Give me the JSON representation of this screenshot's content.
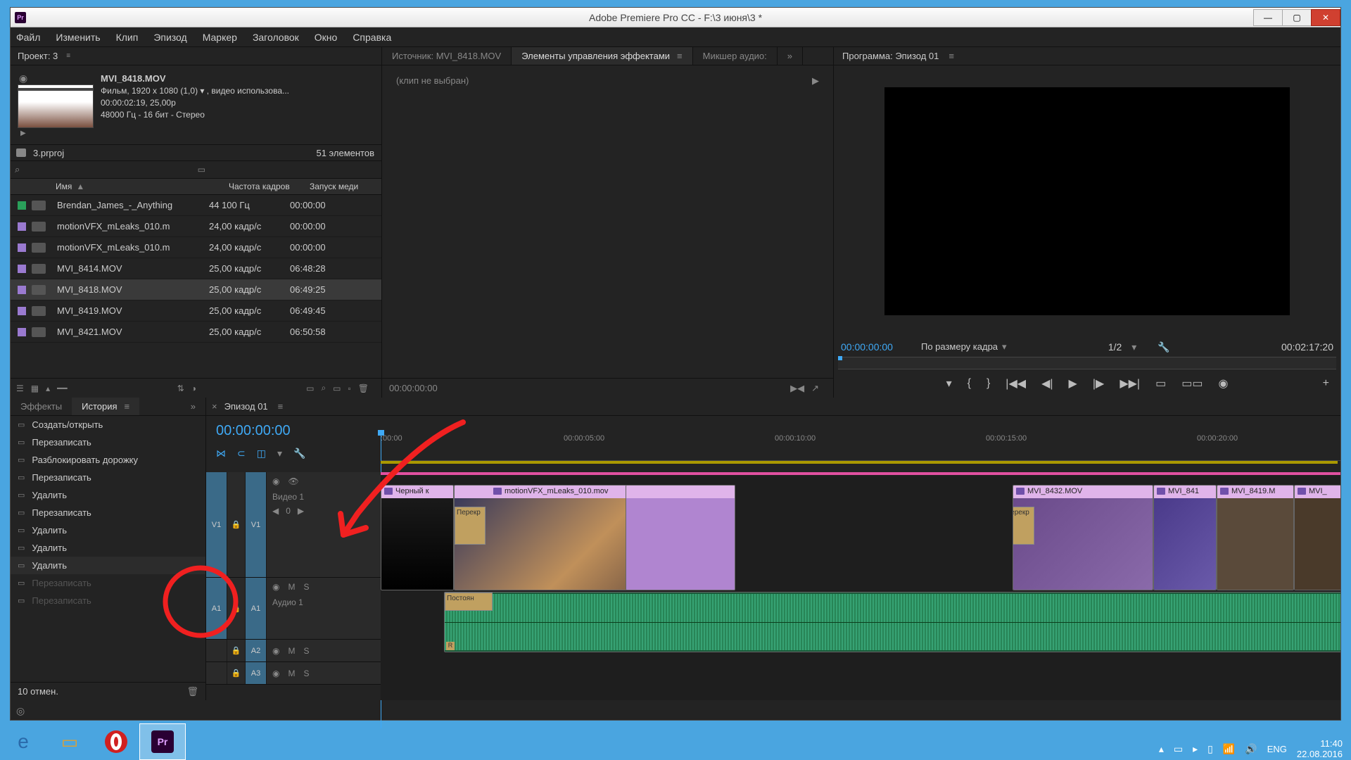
{
  "titlebar": {
    "title": "Adobe Premiere Pro CC - F:\\3 июня\\3 *"
  },
  "menubar": [
    "Файл",
    "Изменить",
    "Клип",
    "Эпизод",
    "Маркер",
    "Заголовок",
    "Окно",
    "Справка"
  ],
  "project": {
    "title": "Проект: 3",
    "clip": {
      "name": "MVI_8418.MOV",
      "line1": "Фильм, 1920 x 1080 (1,0) ▾ , видео использова...",
      "line2": "00:00:02:19, 25,00p",
      "line3": "48000 Гц - 16 бит - Стерео"
    },
    "bin": {
      "name": "3.prproj",
      "count": "51 элементов"
    },
    "cols": {
      "name": "Имя",
      "fps": "Частота кадров",
      "start": "Запуск меди"
    },
    "assets": [
      {
        "color": "#2aa05a",
        "name": "Brendan_James_-_Anything",
        "fps": "44 100 Гц",
        "start": "00:00:00"
      },
      {
        "color": "#9a7ad0",
        "name": "motionVFX_mLeaks_010.m",
        "fps": "24,00 кадр/с",
        "start": "00:00:00"
      },
      {
        "color": "#9a7ad0",
        "name": "motionVFX_mLeaks_010.m",
        "fps": "24,00 кадр/с",
        "start": "00:00:00"
      },
      {
        "color": "#9a7ad0",
        "name": "MVI_8414.MOV",
        "fps": "25,00 кадр/с",
        "start": "06:48:28"
      },
      {
        "color": "#9a7ad0",
        "name": "MVI_8418.MOV",
        "fps": "25,00 кадр/с",
        "start": "06:49:25",
        "sel": true
      },
      {
        "color": "#9a7ad0",
        "name": "MVI_8419.MOV",
        "fps": "25,00 кадр/с",
        "start": "06:49:45"
      },
      {
        "color": "#9a7ad0",
        "name": "MVI_8421.MOV",
        "fps": "25,00 кадр/с",
        "start": "06:50:58"
      }
    ]
  },
  "source": {
    "tabs": [
      "Источник: MVI_8418.MOV",
      "Элементы управления эффектами",
      "Микшер аудио:"
    ],
    "active_tab": 1,
    "empty": "(клип не выбран)",
    "footer_tc": "00:00:00:00"
  },
  "program": {
    "title": "Программа: Эпизод 01",
    "timecode": "00:00:00:00",
    "zoom": "По размеру кадра",
    "page": "1/2",
    "duration": "00:02:17:20"
  },
  "effects": {
    "tab1": "Эффекты",
    "tab2": "История",
    "items": [
      {
        "label": "Создать/открыть",
        "state": ""
      },
      {
        "label": "Перезаписать",
        "state": ""
      },
      {
        "label": "Разблокировать дорожку",
        "state": ""
      },
      {
        "label": "Перезаписать",
        "state": ""
      },
      {
        "label": "Удалить",
        "state": ""
      },
      {
        "label": "Перезаписать",
        "state": ""
      },
      {
        "label": "Удалить",
        "state": ""
      },
      {
        "label": "Удалить",
        "state": ""
      },
      {
        "label": "Удалить",
        "state": "current"
      },
      {
        "label": "Перезаписать",
        "state": "dim"
      },
      {
        "label": "Перезаписать",
        "state": "dim"
      }
    ],
    "footer": "10 отмен."
  },
  "timeline": {
    "name": "Эпизод 01",
    "tc": "00:00:00:00",
    "ticks": [
      {
        "pos": 0,
        "label": ":00:00"
      },
      {
        "pos": 260,
        "label": "00:00:05:00"
      },
      {
        "pos": 560,
        "label": "00:00:10:00"
      },
      {
        "pos": 860,
        "label": "00:00:15:00"
      },
      {
        "pos": 1160,
        "label": "00:00:20:00"
      }
    ],
    "tracks": {
      "v1_src": "V1",
      "v1_tgt": "V1",
      "v1_name": "Видео 1",
      "v1_kf": "0",
      "a1_src": "A1",
      "a1_tgt": "A1",
      "a1_name": "Аудио 1",
      "a2_tgt": "A2",
      "a3_tgt": "A3",
      "mute": "M",
      "solo": "S"
    },
    "clips": {
      "black": "Черный к",
      "leak": "motionVFX_mLeaks_010.mov",
      "trans": "Перекр",
      "mvi32": "MVI_8432.MOV",
      "mvi41": "MVI_841",
      "mvi19": "MVI_8419.M",
      "mvi": "MVI_",
      "audio_trans": "Постоян",
      "audio_r": "R"
    }
  },
  "tray": {
    "lang": "ENG",
    "time": "11:40",
    "date": "22.08.2016"
  }
}
